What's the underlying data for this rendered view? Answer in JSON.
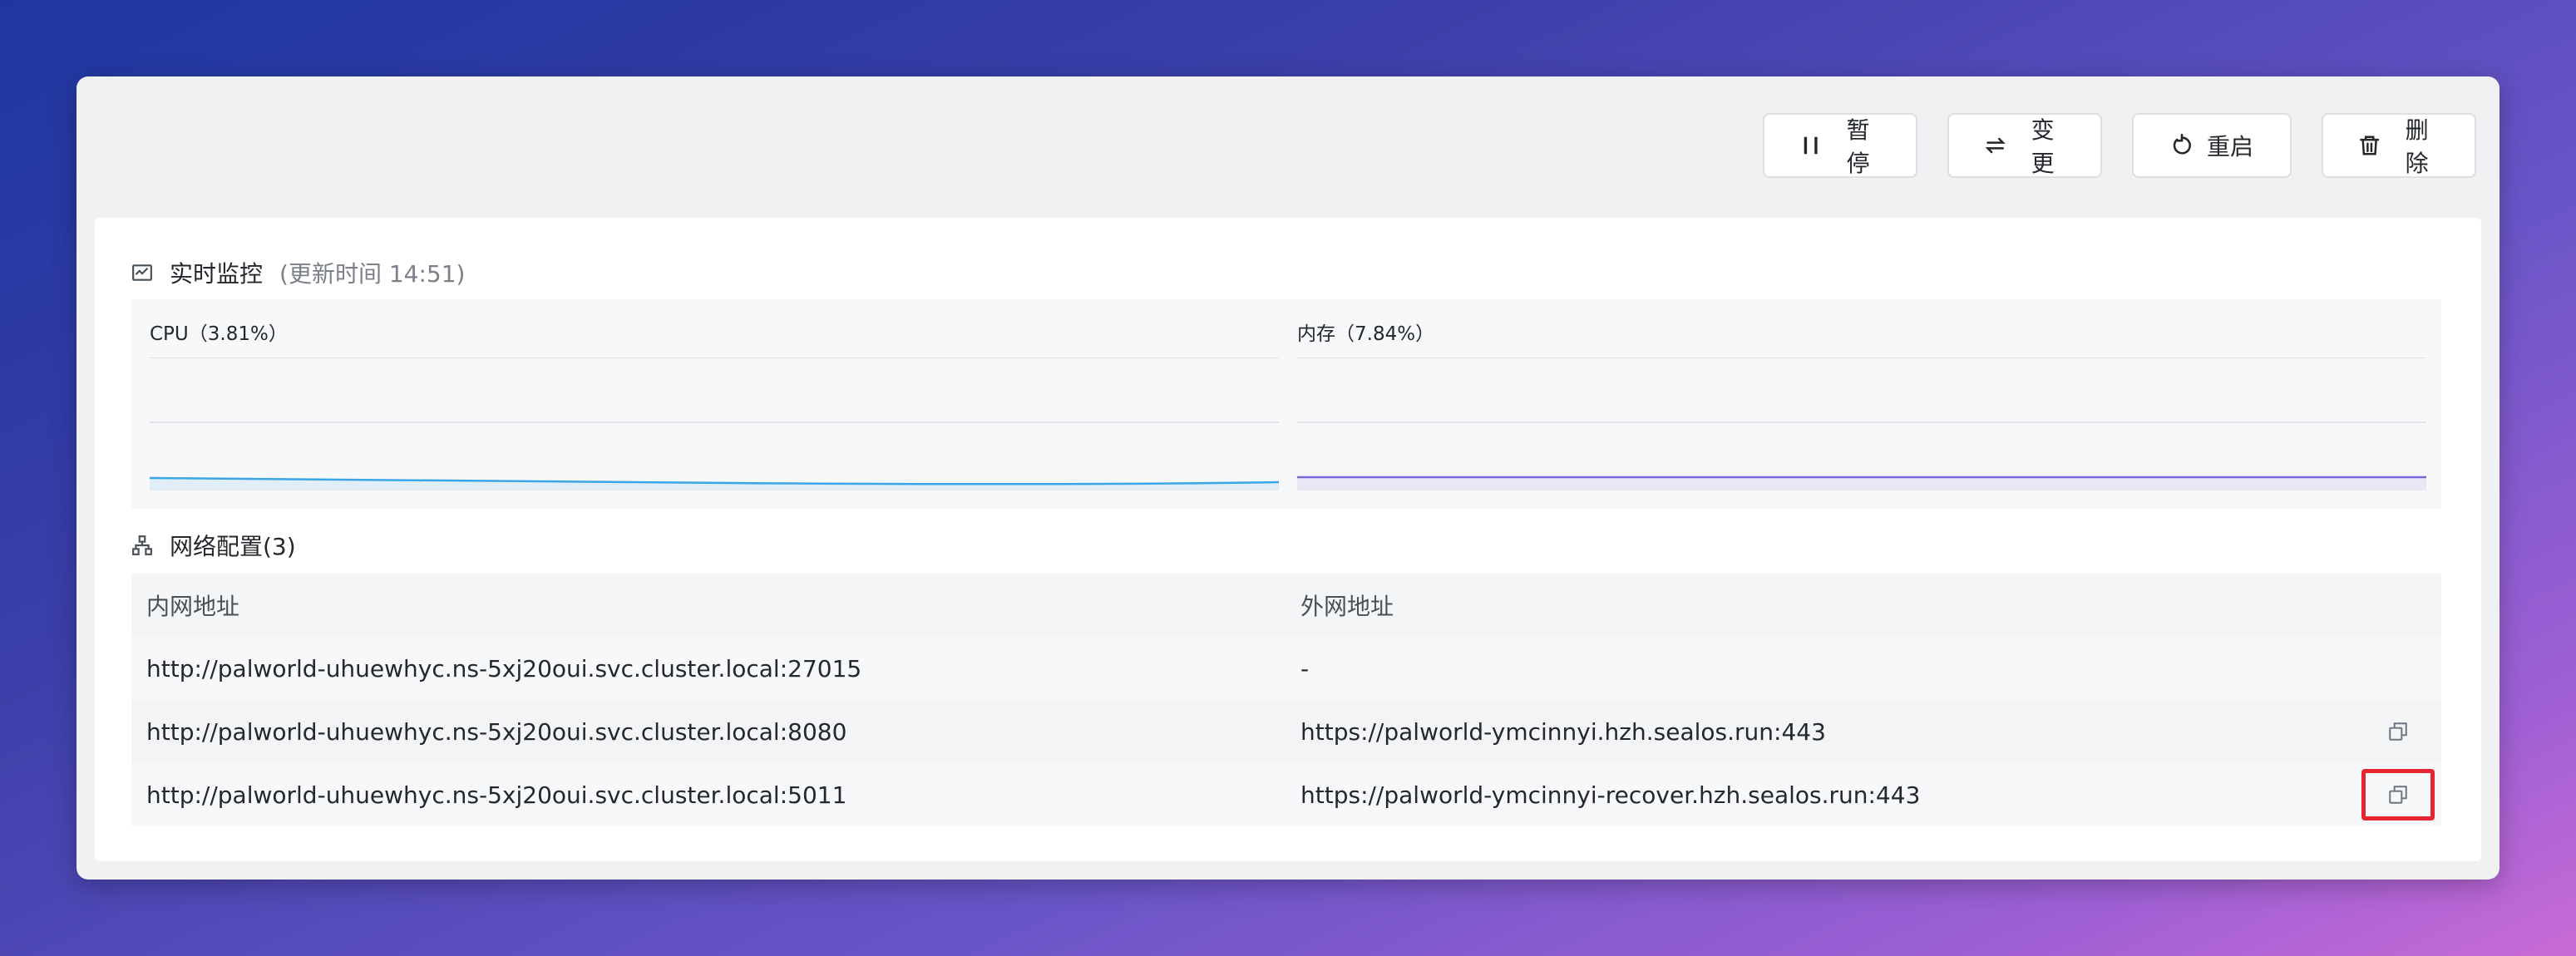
{
  "toolbar": {
    "pause_label": "暂停",
    "change_label": "变更",
    "restart_label": "重启",
    "delete_label": "删除"
  },
  "monitor": {
    "title": "实时监控",
    "updated": "(更新时间  14:51)",
    "cpu_label": "CPU（3.81%）",
    "memory_label": "内存（7.84%）",
    "cpu_color": "#3aa6e6",
    "memory_color": "#7d68d9"
  },
  "network": {
    "title": "网络配置(3)",
    "col_internal": "内网地址",
    "col_external": "外网地址",
    "rows": [
      {
        "internal": "http://palworld-uhuewhyc.ns-5xj20oui.svc.cluster.local:27015",
        "external": "-"
      },
      {
        "internal": "http://palworld-uhuewhyc.ns-5xj20oui.svc.cluster.local:8080",
        "external": "https://palworld-ymcinnyi.hzh.sealos.run:443"
      },
      {
        "internal": "http://palworld-uhuewhyc.ns-5xj20oui.svc.cluster.local:5011",
        "external": "https://palworld-ymcinnyi-recover.hzh.sealos.run:443"
      }
    ]
  }
}
